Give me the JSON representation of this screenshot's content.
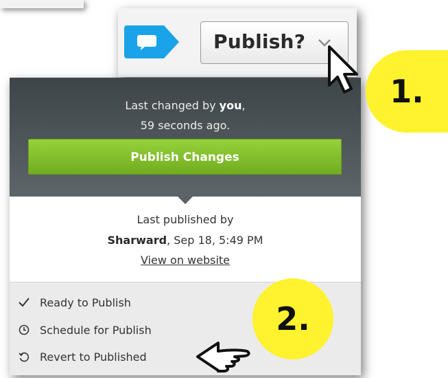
{
  "toolbar": {
    "publish_label": "Publish?"
  },
  "panel": {
    "changed_prefix": "Last changed by ",
    "changed_user": "you",
    "changed_suffix": ",",
    "changed_time": "59 seconds ago.",
    "publish_changes_label": "Publish Changes",
    "published_by_label": "Last published by",
    "published_user": "Sharward",
    "published_date": ", Sep 18, 5:49 PM",
    "view_link": "View on website"
  },
  "menu": {
    "items": [
      {
        "label": "Ready to Publish",
        "icon": "checkmark-icon"
      },
      {
        "label": "Schedule for Publish",
        "icon": "clock-icon"
      },
      {
        "label": "Revert to Published",
        "icon": "revert-icon"
      }
    ]
  },
  "callouts": {
    "step1": "1.",
    "step2": "2."
  },
  "colors": {
    "accent_green": "#7fbe29",
    "dark_panel": "#4a5256",
    "comment_blue": "#1aa3e8",
    "callout_yellow": "#fff22e"
  }
}
